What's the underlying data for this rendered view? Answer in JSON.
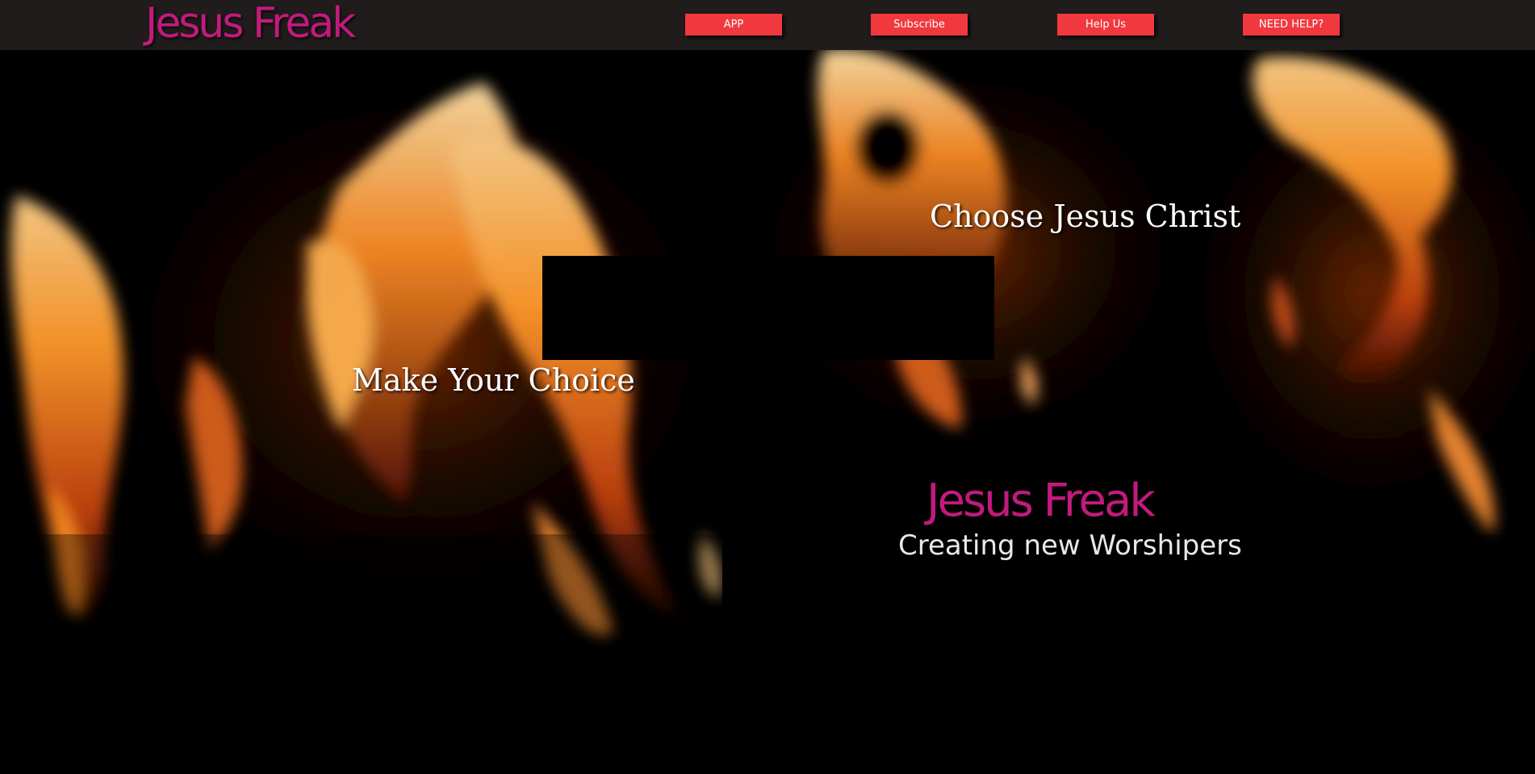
{
  "header": {
    "logo_text": "Jesus Freak",
    "nav": [
      {
        "label": "APP"
      },
      {
        "label": "Subscribe"
      },
      {
        "label": "Help Us"
      },
      {
        "label": "NEED HELP?"
      }
    ]
  },
  "hero": {
    "choose_text": "Choose Jesus Christ",
    "choice_text": "Make Your Choice",
    "brand_text": "Jesus Freak",
    "tagline": "Creating new Worshipers"
  },
  "colors": {
    "header_bg": "#1f1c1b",
    "logo": "#c21a7c",
    "nav_button": "#f2383f",
    "nav_text": "#ffffff",
    "hero_text": "#ffffff",
    "background_image": "fire-flames"
  }
}
